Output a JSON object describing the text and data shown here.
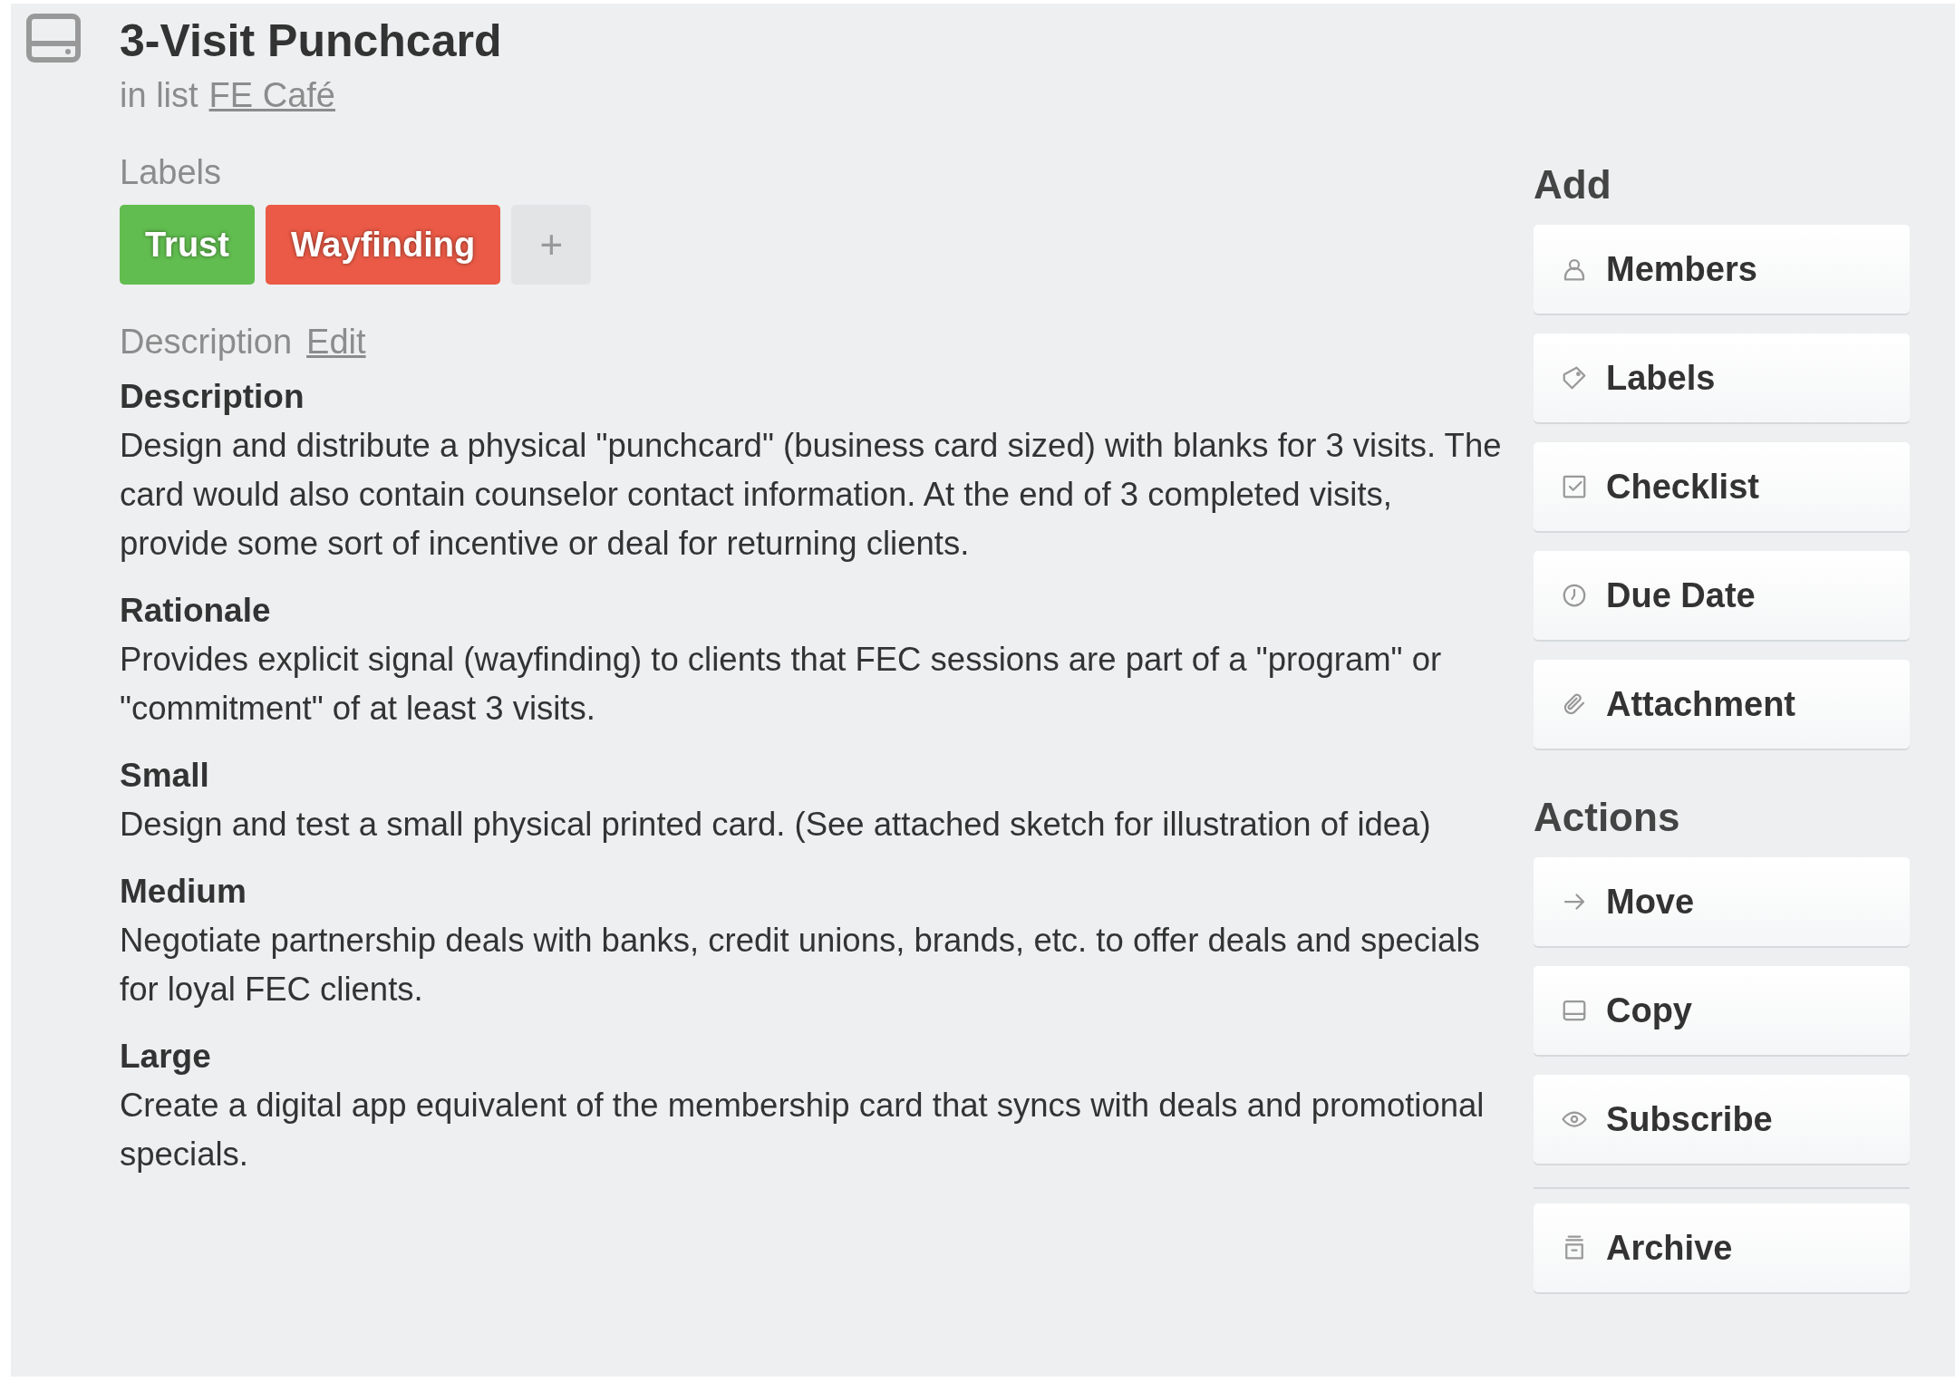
{
  "card": {
    "title": "3-Visit Punchcard",
    "list_prefix": "in list",
    "list_name": "FE Café"
  },
  "labels": {
    "heading": "Labels",
    "items": [
      {
        "text": "Trust",
        "color": "#61bd4f"
      },
      {
        "text": "Wayfinding",
        "color": "#eb5a46"
      }
    ],
    "add": "+"
  },
  "description": {
    "heading": "Description",
    "edit": "Edit",
    "sections": [
      {
        "title": "Description",
        "body": "Design and distribute a physical \"punchcard\" (business card sized) with blanks for 3 visits. The card would also contain counselor contact information. At the end of 3 completed visits, provide some sort of incentive or deal for returning clients."
      },
      {
        "title": "Rationale",
        "body": "Provides explicit signal (wayfinding) to clients that FEC sessions are part of a \"program\" or \"commitment\" of at least 3 visits."
      },
      {
        "title": "Small",
        "body": "Design and test a small physical printed card. (See attached sketch for illustration of idea)"
      },
      {
        "title": "Medium",
        "body": "Negotiate partnership deals with banks, credit unions, brands, etc. to offer deals and specials for loyal FEC clients."
      },
      {
        "title": "Large",
        "body": "Create a digital app equivalent of the membership card that syncs with deals and promotional specials."
      }
    ]
  },
  "sidebar": {
    "add": {
      "heading": "Add",
      "buttons": [
        {
          "label": "Members",
          "kind": "person"
        },
        {
          "label": "Labels",
          "kind": "tag"
        },
        {
          "label": "Checklist",
          "kind": "checkbox"
        },
        {
          "label": "Due Date",
          "kind": "clock"
        },
        {
          "label": "Attachment",
          "kind": "paperclip"
        }
      ]
    },
    "actions": {
      "heading": "Actions",
      "buttons": [
        {
          "label": "Move",
          "kind": "arrow"
        },
        {
          "label": "Copy",
          "kind": "card"
        },
        {
          "label": "Subscribe",
          "kind": "eye"
        }
      ],
      "after_divider": [
        {
          "label": "Archive",
          "kind": "archive"
        }
      ]
    }
  }
}
